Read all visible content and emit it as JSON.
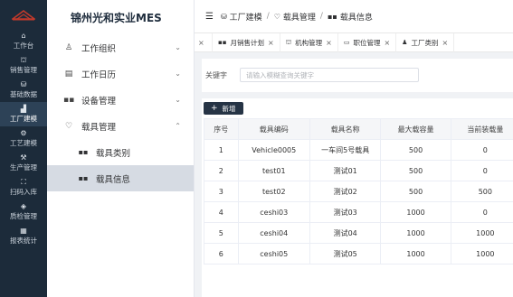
{
  "rail": {
    "items": [
      {
        "label": "工作台",
        "icon": "home-icon"
      },
      {
        "label": "销售管理",
        "icon": "sales-icon"
      },
      {
        "label": "基础数据",
        "icon": "database-icon"
      },
      {
        "label": "工厂建模",
        "icon": "factory-icon",
        "active": true
      },
      {
        "label": "工艺建模",
        "icon": "process-icon"
      },
      {
        "label": "生产管理",
        "icon": "production-icon"
      },
      {
        "label": "扫码入库",
        "icon": "scan-icon"
      },
      {
        "label": "质检管理",
        "icon": "quality-icon"
      },
      {
        "label": "报表统计",
        "icon": "report-icon"
      }
    ]
  },
  "menu": {
    "title": "锦州光和实业MES",
    "items": [
      {
        "label": "工作组织",
        "icon": "org-icon"
      },
      {
        "label": "工作日历",
        "icon": "calendar-icon"
      },
      {
        "label": "设备管理",
        "icon": "device-icon"
      },
      {
        "label": "载具管理",
        "icon": "carrier-icon",
        "expanded": true
      }
    ],
    "sub_items": [
      {
        "label": "载具类别",
        "icon": "grid-icon"
      },
      {
        "label": "载具信息",
        "icon": "grid-icon",
        "active": true
      }
    ]
  },
  "breadcrumb": [
    "工厂建模",
    "载具管理",
    "载具信息"
  ],
  "tabs": [
    {
      "label": "月销售计划"
    },
    {
      "label": "机构管理"
    },
    {
      "label": "职位管理"
    },
    {
      "label": "工厂类别"
    }
  ],
  "search": {
    "label": "关键字",
    "placeholder": "请输入模糊查询关键字"
  },
  "toolbar": {
    "add_label": "新增"
  },
  "table": {
    "columns": [
      "序号",
      "载具编码",
      "载具名称",
      "最大载容量",
      "当前装载量"
    ],
    "rows": [
      [
        "1",
        "Vehicle0005",
        "一车间5号载具",
        "500",
        "0"
      ],
      [
        "2",
        "test01",
        "测试01",
        "500",
        "0"
      ],
      [
        "3",
        "test02",
        "测试02",
        "500",
        "500"
      ],
      [
        "4",
        "ceshi03",
        "测试03",
        "1000",
        "0"
      ],
      [
        "5",
        "ceshi04",
        "测试04",
        "1000",
        "1000"
      ],
      [
        "6",
        "ceshi05",
        "测试05",
        "1000",
        "1000"
      ]
    ]
  },
  "colors": {
    "rail_bg": "#1c2b3a",
    "accent": "#263445",
    "brand": "#c0392b"
  }
}
